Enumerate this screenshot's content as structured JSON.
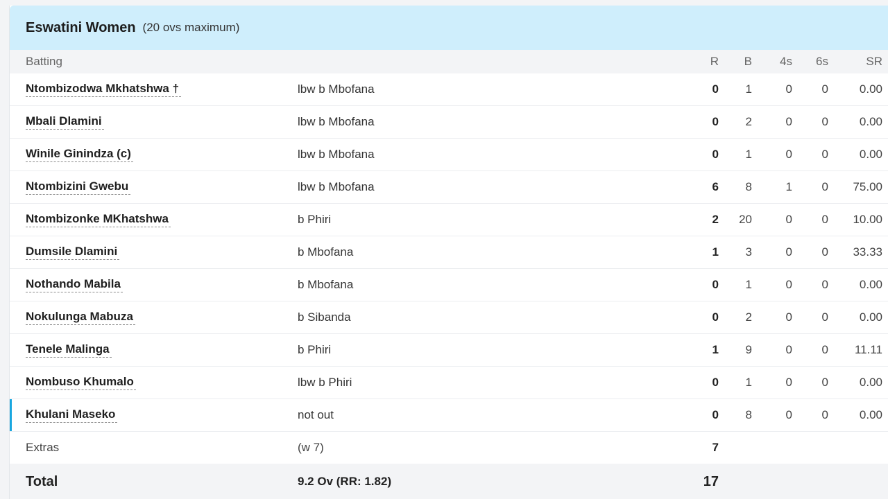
{
  "team": {
    "name": "Eswatini Women",
    "subtitle": "(20 ovs maximum)"
  },
  "columns": {
    "batting": "Batting",
    "r": "R",
    "b": "B",
    "fours": "4s",
    "sixes": "6s",
    "sr": "SR"
  },
  "batters": [
    {
      "name": "Ntombizodwa Mkhatshwa †",
      "dismissal": "lbw b Mbofana",
      "r": "0",
      "b": "1",
      "fours": "0",
      "sixes": "0",
      "sr": "0.00"
    },
    {
      "name": "Mbali Dlamini",
      "dismissal": "lbw b Mbofana",
      "r": "0",
      "b": "2",
      "fours": "0",
      "sixes": "0",
      "sr": "0.00"
    },
    {
      "name": "Winile Ginindza (c)",
      "dismissal": "lbw b Mbofana",
      "r": "0",
      "b": "1",
      "fours": "0",
      "sixes": "0",
      "sr": "0.00"
    },
    {
      "name": "Ntombizini Gwebu",
      "dismissal": "lbw b Mbofana",
      "r": "6",
      "b": "8",
      "fours": "1",
      "sixes": "0",
      "sr": "75.00"
    },
    {
      "name": "Ntombizonke MKhatshwa",
      "dismissal": "b Phiri",
      "r": "2",
      "b": "20",
      "fours": "0",
      "sixes": "0",
      "sr": "10.00"
    },
    {
      "name": "Dumsile Dlamini",
      "dismissal": "b Mbofana",
      "r": "1",
      "b": "3",
      "fours": "0",
      "sixes": "0",
      "sr": "33.33"
    },
    {
      "name": "Nothando Mabila",
      "dismissal": "b Mbofana",
      "r": "0",
      "b": "1",
      "fours": "0",
      "sixes": "0",
      "sr": "0.00"
    },
    {
      "name": "Nokulunga Mabuza",
      "dismissal": "b Sibanda",
      "r": "0",
      "b": "2",
      "fours": "0",
      "sixes": "0",
      "sr": "0.00"
    },
    {
      "name": "Tenele Malinga",
      "dismissal": "b Phiri",
      "r": "1",
      "b": "9",
      "fours": "0",
      "sixes": "0",
      "sr": "11.11"
    },
    {
      "name": "Nombuso Khumalo",
      "dismissal": "lbw b Phiri",
      "r": "0",
      "b": "1",
      "fours": "0",
      "sixes": "0",
      "sr": "0.00"
    },
    {
      "name": "Khulani Maseko",
      "dismissal": "not out",
      "r": "0",
      "b": "8",
      "fours": "0",
      "sixes": "0",
      "sr": "0.00"
    }
  ],
  "extras": {
    "label": "Extras",
    "detail": "(w 7)",
    "runs": "7"
  },
  "total": {
    "label": "Total",
    "detail": "9.2 Ov (RR: 1.82)",
    "runs": "17"
  },
  "colors": {
    "header_bg": "#cfeefc",
    "active_indicator": "#19a7e0"
  }
}
